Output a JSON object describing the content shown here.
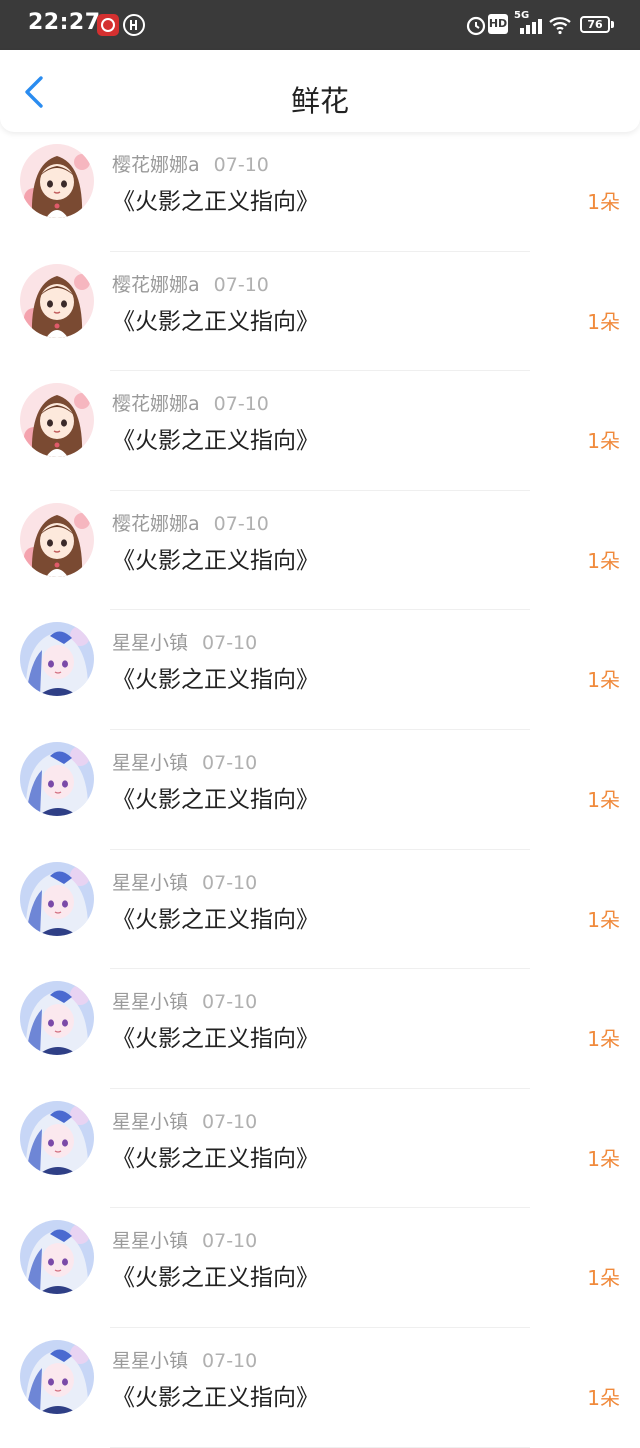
{
  "status_bar": {
    "time": "22:27",
    "network": "5G",
    "hd_badge": "HD",
    "battery": "76"
  },
  "header": {
    "title": "鲜花",
    "back_icon": "chevron-left-icon"
  },
  "colors": {
    "accent_blue": "#2a8cf0",
    "count_orange": "#f08a3c"
  },
  "rows": [
    {
      "user": "樱花娜娜a",
      "date": "07-10",
      "title": "《火影之正义指向》",
      "count": "1朵",
      "avatar": "avatar-girl-brown-hair"
    },
    {
      "user": "樱花娜娜a",
      "date": "07-10",
      "title": "《火影之正义指向》",
      "count": "1朵",
      "avatar": "avatar-girl-brown-hair"
    },
    {
      "user": "樱花娜娜a",
      "date": "07-10",
      "title": "《火影之正义指向》",
      "count": "1朵",
      "avatar": "avatar-girl-brown-hair"
    },
    {
      "user": "樱花娜娜a",
      "date": "07-10",
      "title": "《火影之正义指向》",
      "count": "1朵",
      "avatar": "avatar-girl-brown-hair"
    },
    {
      "user": "星星小镇",
      "date": "07-10",
      "title": "《火影之正义指向》",
      "count": "1朵",
      "avatar": "avatar-girl-blue-hair"
    },
    {
      "user": "星星小镇",
      "date": "07-10",
      "title": "《火影之正义指向》",
      "count": "1朵",
      "avatar": "avatar-girl-blue-hair"
    },
    {
      "user": "星星小镇",
      "date": "07-10",
      "title": "《火影之正义指向》",
      "count": "1朵",
      "avatar": "avatar-girl-blue-hair"
    },
    {
      "user": "星星小镇",
      "date": "07-10",
      "title": "《火影之正义指向》",
      "count": "1朵",
      "avatar": "avatar-girl-blue-hair"
    },
    {
      "user": "星星小镇",
      "date": "07-10",
      "title": "《火影之正义指向》",
      "count": "1朵",
      "avatar": "avatar-girl-blue-hair"
    },
    {
      "user": "星星小镇",
      "date": "07-10",
      "title": "《火影之正义指向》",
      "count": "1朵",
      "avatar": "avatar-girl-blue-hair"
    },
    {
      "user": "星星小镇",
      "date": "07-10",
      "title": "《火影之正义指向》",
      "count": "1朵",
      "avatar": "avatar-girl-blue-hair"
    }
  ]
}
